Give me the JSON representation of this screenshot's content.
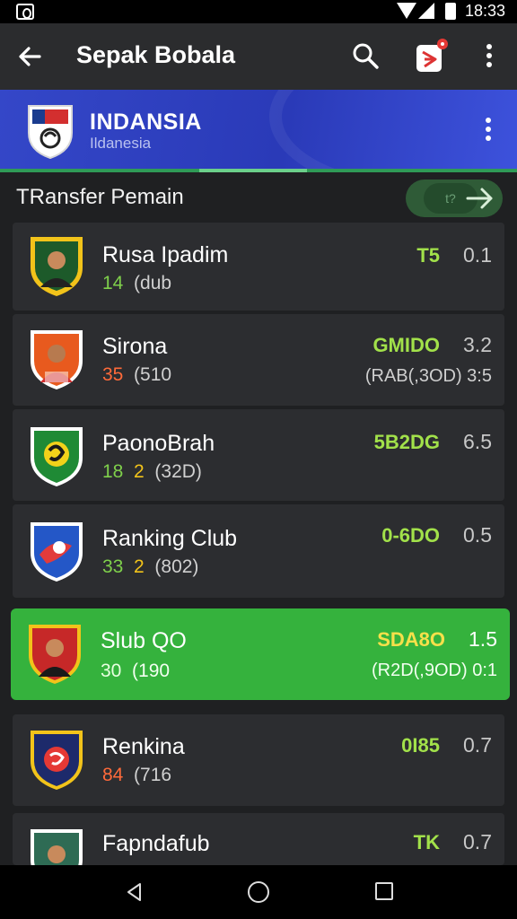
{
  "status_bar": {
    "time": "18:33"
  },
  "app_bar": {
    "title": "Sepak Bobala"
  },
  "club": {
    "name": "INDANSIA",
    "subtitle": "Ildanesia"
  },
  "section": {
    "title": "TRansfer Pemain",
    "toggle_label": "t?"
  },
  "players": [
    {
      "name": "Rusa Ipadim",
      "stat_a": "14",
      "stat_b": "",
      "stat_extra": "(dub",
      "code": "T5",
      "rating": "0.1",
      "sub": "",
      "stat_a_color": "green"
    },
    {
      "name": "Sirona",
      "stat_a": "35",
      "stat_b": "",
      "stat_extra": "(510",
      "code": "GMIDO",
      "rating": "3.2",
      "sub": "(RAB(,3OD) 3:5",
      "stat_a_color": "orange"
    },
    {
      "name": "PaonoBrah",
      "stat_a": "18",
      "stat_b": "2",
      "stat_extra": "(32D)",
      "code": "5B2DG",
      "rating": "6.5",
      "sub": "",
      "stat_a_color": "green"
    },
    {
      "name": "Ranking Club",
      "stat_a": "33",
      "stat_b": "2",
      "stat_extra": "(802)",
      "code": "0-6DO",
      "rating": "0.5",
      "sub": "",
      "stat_a_color": "green"
    },
    {
      "name": "Slub QO",
      "stat_a": "30",
      "stat_b": "",
      "stat_extra": "(190",
      "code": "SDA8O",
      "rating": "1.5",
      "sub": "(R2D(,9OD) 0:1",
      "stat_a_color": "green",
      "active": true
    },
    {
      "name": "Renkina",
      "stat_a": "84",
      "stat_b": "",
      "stat_extra": "(716",
      "code": "0I85",
      "rating": "0.7",
      "sub": "",
      "stat_a_color": "orange"
    },
    {
      "name": "Fapndafub",
      "stat_a": "",
      "stat_b": "",
      "stat_extra": "",
      "code": "TK",
      "rating": "0.7",
      "sub": "",
      "stat_a_color": "green"
    }
  ]
}
